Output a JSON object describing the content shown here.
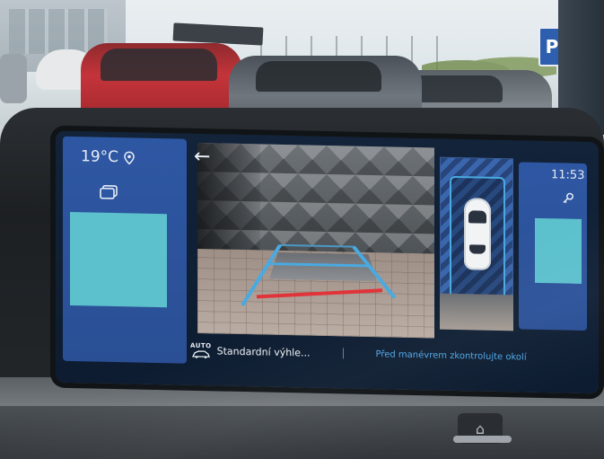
{
  "climate": {
    "temperature": "19°C"
  },
  "clock": {
    "time": "11:53"
  },
  "parking": {
    "view_mode_label": "Standardní výhle...",
    "auto_badge": "AUTO",
    "safety_message": "Před manévrem zkontrolujte okolí"
  },
  "signs": {
    "parking_sign_letter": "P"
  },
  "icons": {
    "location": "location-pin-icon",
    "camera_switch": "camera-switch-icon",
    "back": "back-arrow-icon",
    "key": "key-icon",
    "auto_car": "auto-car-icon",
    "home": "home-icon"
  },
  "colors": {
    "panel_blue": "#2e57a3",
    "teal": "#5cc0cd",
    "guide_blue": "#4aa9e0",
    "guide_red": "#e0343a",
    "warning_blue": "#4ea8e8"
  }
}
